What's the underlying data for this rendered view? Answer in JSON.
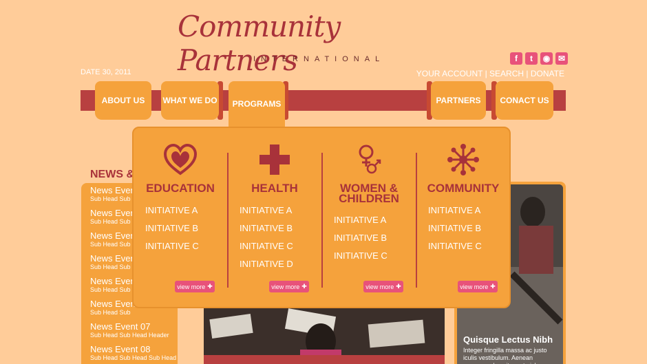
{
  "brand": {
    "title": "Community Partners",
    "subtitle": "INTERNATIONAL"
  },
  "social": [
    {
      "icon": "facebook-icon",
      "glyph": "f"
    },
    {
      "icon": "twitter-icon",
      "glyph": "t"
    },
    {
      "icon": "rss-icon",
      "glyph": "◉"
    },
    {
      "icon": "email-icon",
      "glyph": "✉"
    }
  ],
  "header": {
    "date": "DATE 30, 2011",
    "account": "YOUR ACCOUNT",
    "search": "SEARCH",
    "donate": "DONATE",
    "sep": "|"
  },
  "nav": [
    {
      "label": "ABOUT US"
    },
    {
      "label": "WHAT WE DO"
    },
    {
      "label": "PROGRAMS"
    },
    {
      "label": "PARTNERS"
    },
    {
      "label": "CONACT US"
    }
  ],
  "mega": [
    {
      "title": "EDUCATION",
      "icon": "education-heart-icon",
      "items": [
        "INITIATIVE A",
        "INITIATIVE B",
        "INITIATIVE C"
      ],
      "view_more": "view more"
    },
    {
      "title": "HEALTH",
      "icon": "health-cross-icon",
      "items": [
        "INITIATIVE A",
        "INITIATIVE B",
        "INITIATIVE C",
        "INITIATIVE D"
      ],
      "view_more": "view more"
    },
    {
      "title": "WOMEN &",
      "title2": "CHILDREN",
      "icon": "women-children-icon",
      "items": [
        "INITIATIVE A",
        "INITIATIVE B",
        "INITIATIVE C"
      ],
      "view_more": "view more"
    },
    {
      "title": "COMMUNITY",
      "icon": "community-icon",
      "items": [
        "INITIATIVE A",
        "INITIATIVE B",
        "INITIATIVE C"
      ],
      "view_more": "view more"
    }
  ],
  "news": {
    "heading": "NEWS &",
    "items": [
      {
        "title": "News Event",
        "sub": "Sub Head Sub"
      },
      {
        "title": "News Event",
        "sub": "Sub Head Sub"
      },
      {
        "title": "News Event",
        "sub": "Sub Head Sub"
      },
      {
        "title": "News Event",
        "sub": "Sub Head Sub"
      },
      {
        "title": "News Event",
        "sub": "Sub Head Sub"
      },
      {
        "title": "News Event",
        "sub": "Sub Head Sub"
      },
      {
        "title": "News Event 07",
        "sub": "Sub Head Sub Head Header"
      },
      {
        "title": "News Event 08",
        "sub": "Sub Head Sub Head Sub Head"
      }
    ]
  },
  "feature": {
    "heading": "Quisque Lectus Nibh",
    "body": "Integer fringilla massa ac justo iculis vestibulum. Aenean accumsan leo sit amet nisl"
  },
  "colors": {
    "background": "#ffcc99",
    "orange": "#f5a23c",
    "maroon": "#b84040",
    "pink": "#e8527a"
  }
}
